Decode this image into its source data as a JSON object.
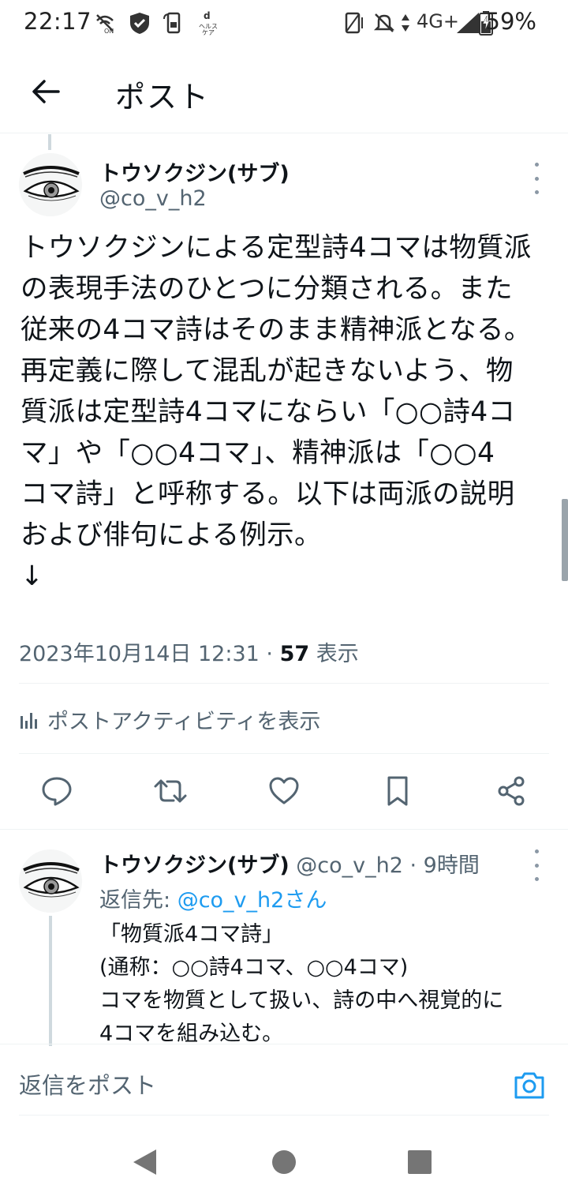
{
  "status_bar": {
    "time": "22:17",
    "network": "4G+",
    "battery": "59%",
    "icons": [
      "nfc-off-icon",
      "shield-check-icon",
      "phone-sync-icon",
      "health-icon",
      "vibrate-icon",
      "mute-icon",
      "data-arrows-icon",
      "signal-icon",
      "battery-icon"
    ]
  },
  "header": {
    "back_icon": "arrow-left-icon",
    "title": "ポスト"
  },
  "main_post": {
    "author_name": "トウソクジン(サブ)",
    "author_handle": "@co_v_h2",
    "avatar": "eye-drawing-avatar",
    "text": "トウソクジンによる定型詩4コマは物質派\nの表現手法のひとつに分類される。また\n従来の4コマ詩はそのまま精神派となる。\n再定義に際して混乱が起きないよう、物\n質派は定型詩4コマにならい「○○詩4コ\nマ」や「○○4コマ」、精神派は「○○4\nコマ詩」と呼称する。以下は両派の説明\nおよび俳句による例示。\n↓",
    "timestamp": "2023年10月14日 12:31",
    "separator": "·",
    "views_count": "57",
    "views_label": "表示",
    "activity_label": "ポストアクティビティを表示",
    "actions": [
      "reply-icon",
      "repost-icon",
      "like-icon",
      "bookmark-icon",
      "share-icon"
    ]
  },
  "reply_post": {
    "author_name": "トウソクジン(サブ)",
    "meta": "@co_v_h2 · 9時間",
    "reply_to_prefix": "返信先: ",
    "reply_to_handle": "@co_v_h2さん",
    "text": "「物質派4コマ詩」\n(通称：○○詩4コマ、○○4コマ)\nコマを物質として扱い、詩の中へ視覚的に\n4コマを組み込む。"
  },
  "composer": {
    "placeholder": "返信をポスト",
    "camera_icon": "camera-icon"
  },
  "colors": {
    "accent": "#1d9bf0",
    "text": "#0f1419",
    "secondary": "#536471",
    "divider": "#eff3f4"
  }
}
